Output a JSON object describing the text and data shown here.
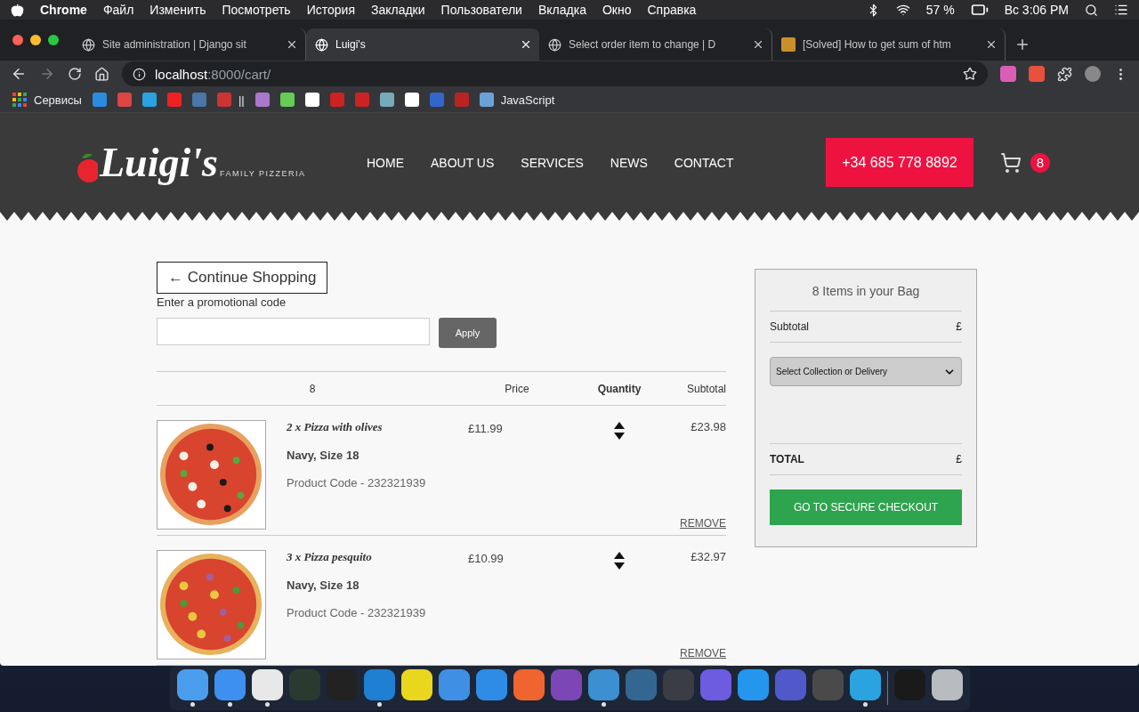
{
  "menubar": {
    "app": "Chrome",
    "menus": [
      "Файл",
      "Изменить",
      "Посмотреть",
      "История",
      "Закладки",
      "Пользователи",
      "Вкладка",
      "Окно",
      "Справка"
    ],
    "battery": "57 %",
    "clock": "Вс 3:06 PM"
  },
  "tabs": [
    {
      "title": "Site administration | Django sit",
      "selected": false,
      "kind": "globe"
    },
    {
      "title": "Luigi's",
      "selected": true,
      "kind": "globe"
    },
    {
      "title": "Select order item to change | D",
      "selected": false,
      "kind": "globe"
    },
    {
      "title": "[Solved] How to get sum of htm",
      "selected": false
    }
  ],
  "toolbar": {
    "url_host": "localhost",
    "url_path": ":8000/cart/"
  },
  "bookmarks": [
    {
      "kind": "apps",
      "label": "Сервисы"
    },
    {
      "kind": "site"
    },
    {
      "kind": "site"
    },
    {
      "kind": "site"
    },
    {
      "kind": "site"
    },
    {
      "kind": "site"
    },
    {
      "kind": "site",
      "label": "||"
    },
    {
      "kind": "site"
    },
    {
      "kind": "site"
    },
    {
      "kind": "site"
    },
    {
      "kind": "site"
    },
    {
      "kind": "site"
    },
    {
      "kind": "site"
    },
    {
      "kind": "site"
    },
    {
      "kind": "site"
    },
    {
      "kind": "site"
    },
    {
      "kind": "site",
      "label": "JavaScript"
    }
  ],
  "site": {
    "logo": {
      "name": "Luigi's",
      "tagline": "FAMILY PIZZERIA"
    },
    "nav": [
      "HOME",
      "ABOUT US",
      "SERVICES",
      "NEWS",
      "CONTACT"
    ],
    "phone": "+34 685 778 8892",
    "cart_count": "8"
  },
  "cart": {
    "continue": "← Continue Shopping",
    "promo_label": "Enter a promotional code",
    "apply": "Apply",
    "columns": [
      "8",
      "Price",
      "Quantity",
      "Subtotal"
    ],
    "items": [
      {
        "title": "2 x Pizza with olives",
        "variant": "Navy, Size 18",
        "code": "Product Code - 232321939",
        "price": "£11.99",
        "subtotal": "£23.98",
        "remove": "REMOVE"
      },
      {
        "title": "3 x Pizza pesquito",
        "variant": "Navy, Size 18",
        "code": "Product Code - 232321939",
        "price": "£10.99",
        "subtotal": "£32.97",
        "remove": "REMOVE"
      }
    ]
  },
  "summary": {
    "title": "8 Items in your Bag",
    "subtotal_label": "Subtotal",
    "subtotal_value": "£",
    "delivery_placeholder": "Select Collection or Delivery",
    "total_label": "TOTAL",
    "total_value": "£",
    "checkout": "GO TO SECURE CHECKOUT"
  },
  "dock": [
    {
      "kind": "finder",
      "running": true
    },
    {
      "kind": "safari",
      "running": true
    },
    {
      "kind": "chrome",
      "running": true
    },
    {
      "kind": "monitor",
      "running": false
    },
    {
      "kind": "terminal",
      "running": false
    },
    {
      "kind": "vscode",
      "running": true
    },
    {
      "kind": "pycharm",
      "running": false
    },
    {
      "kind": "xcode",
      "running": false
    },
    {
      "kind": "appstore",
      "running": false
    },
    {
      "kind": "postman",
      "running": false
    },
    {
      "kind": "github",
      "running": false
    },
    {
      "kind": "elephant",
      "running": true
    },
    {
      "kind": "postgres",
      "running": false
    },
    {
      "kind": "flask",
      "running": false
    },
    {
      "kind": "dbeaver",
      "running": false
    },
    {
      "kind": "docker",
      "running": false
    },
    {
      "kind": "teams",
      "running": false
    },
    {
      "kind": "sublime",
      "running": false
    },
    {
      "kind": "telegram",
      "running": true
    },
    {
      "kind": "divider"
    },
    {
      "kind": "preview",
      "running": false
    },
    {
      "kind": "trash",
      "running": false
    }
  ]
}
